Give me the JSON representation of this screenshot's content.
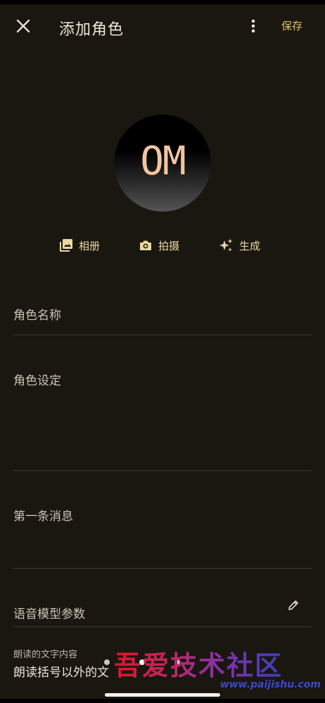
{
  "header": {
    "close_icon": "close-icon",
    "title": "添加角色",
    "more_icon": "more-vert-icon",
    "save_label": "保存"
  },
  "avatar": {
    "text": "OM"
  },
  "image_actions": [
    {
      "icon": "photo-library-icon",
      "label": "相册"
    },
    {
      "icon": "camera-icon",
      "label": "拍摄"
    },
    {
      "icon": "sparkle-icon",
      "label": "生成"
    }
  ],
  "form": {
    "name_label": "角色名称",
    "setting_label": "角色设定",
    "first_message_label": "第一条消息",
    "voice_params_label": "语音模型参数",
    "voice_edit_icon": "pencil-icon",
    "read_text_label": "朗读的文字内容",
    "read_text_value": "朗读括号以外的文"
  },
  "watermark": {
    "text": "吾爱技术社区",
    "url": "www.paijishu.com"
  },
  "colors": {
    "background": "#19170f",
    "accent": "#e2c26a",
    "divider": "#3d3a31"
  }
}
